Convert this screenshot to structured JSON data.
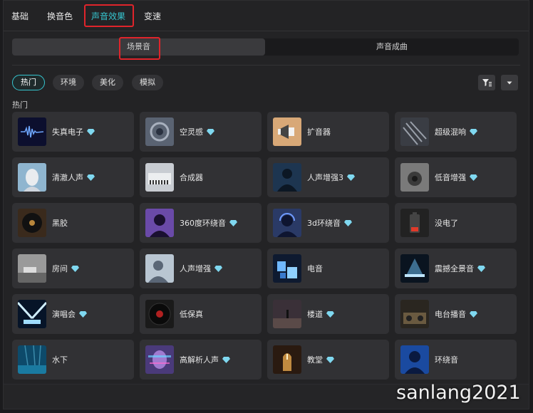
{
  "tabs": [
    {
      "label": "基础"
    },
    {
      "label": "换音色"
    },
    {
      "label": "声音效果"
    },
    {
      "label": "变速"
    }
  ],
  "segments": [
    {
      "label": "场景音"
    },
    {
      "label": "声音成曲"
    }
  ],
  "chips": [
    {
      "label": "热门"
    },
    {
      "label": "环境"
    },
    {
      "label": "美化"
    },
    {
      "label": "模拟"
    }
  ],
  "section_label": "热门",
  "items": [
    {
      "label": "失真电子",
      "premium": true,
      "thumb": "electronic-wave"
    },
    {
      "label": "空灵感",
      "premium": true,
      "thumb": "swirl"
    },
    {
      "label": "扩音器",
      "premium": false,
      "thumb": "megaphone"
    },
    {
      "label": "超级混响",
      "premium": true,
      "thumb": "mixer"
    },
    {
      "label": "清澈人声",
      "premium": true,
      "thumb": "face"
    },
    {
      "label": "合成器",
      "premium": false,
      "thumb": "synth"
    },
    {
      "label": "人声增强3",
      "premium": true,
      "thumb": "singer"
    },
    {
      "label": "低音增强",
      "premium": true,
      "thumb": "speaker"
    },
    {
      "label": "黑胶",
      "premium": false,
      "thumb": "vinyl"
    },
    {
      "label": "360度环绕音",
      "premium": true,
      "thumb": "purple-head"
    },
    {
      "label": "3d环绕音",
      "premium": true,
      "thumb": "headphones"
    },
    {
      "label": "没电了",
      "premium": false,
      "thumb": "battery"
    },
    {
      "label": "房间",
      "premium": true,
      "thumb": "room"
    },
    {
      "label": "人声增强",
      "premium": true,
      "thumb": "silhouette"
    },
    {
      "label": "电音",
      "premium": false,
      "thumb": "blocks"
    },
    {
      "label": "震撼全景音",
      "premium": true,
      "thumb": "stage"
    },
    {
      "label": "演唱会",
      "premium": true,
      "thumb": "concert"
    },
    {
      "label": "低保真",
      "premium": false,
      "thumb": "record"
    },
    {
      "label": "楼道",
      "premium": true,
      "thumb": "corridor"
    },
    {
      "label": "电台播音",
      "premium": true,
      "thumb": "radio"
    },
    {
      "label": "水下",
      "premium": false,
      "thumb": "underwater"
    },
    {
      "label": "高解析人声",
      "premium": true,
      "thumb": "glitch-face"
    },
    {
      "label": "教堂",
      "premium": true,
      "thumb": "church"
    },
    {
      "label": "环绕音",
      "premium": false,
      "thumb": "blue-profile"
    }
  ],
  "watermark": "sanlang2021",
  "colors": {
    "accent": "#36c5cf",
    "highlight_box": "#e0242b",
    "gem": "#7fd8f0"
  }
}
